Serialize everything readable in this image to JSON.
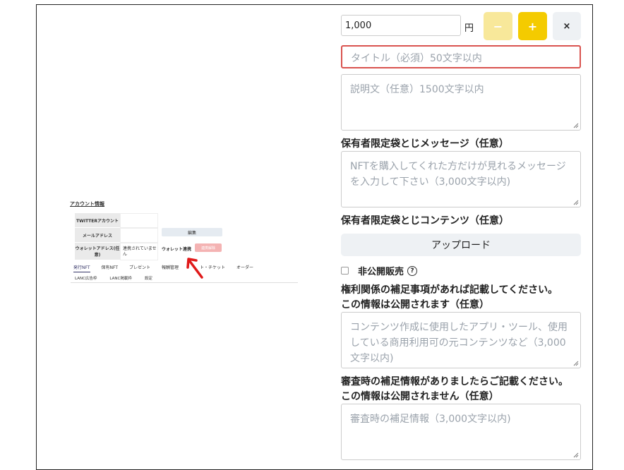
{
  "thumbnail": {
    "section_title": "アカウント情報",
    "rows": [
      {
        "label": "TWITTERアカウント",
        "value": ""
      },
      {
        "label": "メールアドレス",
        "value": ""
      },
      {
        "label": "ウォレットアドレス(任意)",
        "value": "連携されていません"
      }
    ],
    "edit_label": "編集",
    "wallet_label": "ウォレット連携",
    "unlink_label": "連携解除",
    "tabs": [
      "発行NFT",
      "保有NFT",
      "プレゼント",
      "報酬管理",
      "ト・チケット",
      "オーダー"
    ],
    "tabs2": [
      "LANC広告枠",
      "LANC掲載枠",
      "設定"
    ]
  },
  "form": {
    "price_value": "1,000",
    "currency": "円",
    "minus_label": "−",
    "plus_label": "+",
    "close_label": "×",
    "title_placeholder": "タイトル（必須）50文字以内",
    "description_placeholder": "説明文（任意）1500文字以内",
    "holder_message_label": "保有者限定袋とじメッセージ（任意）",
    "holder_message_placeholder": "NFTを購入してくれた方だけが見れるメッセージを入力して下さい（3,000文字以内)",
    "holder_content_label": "保有者限定袋とじコンテンツ（任意）",
    "upload_label": "アップロード",
    "private_sale_label": "非公開販売",
    "help_glyph": "?",
    "rights_label_1": "権利関係の補足事項があれば記載してください。",
    "rights_label_2": "この情報は公開されます（任意）",
    "rights_placeholder": "コンテンツ作成に使用したアプリ・ツール、使用している商用利用可の元コンテンツなど（3,000文字以内)",
    "review_label_1": "審査時の補足情報がありましたらご記載ください。",
    "review_label_2": "この情報は公開されません（任意）",
    "review_placeholder": "審査時の補足情報（3,000文字以内)"
  }
}
